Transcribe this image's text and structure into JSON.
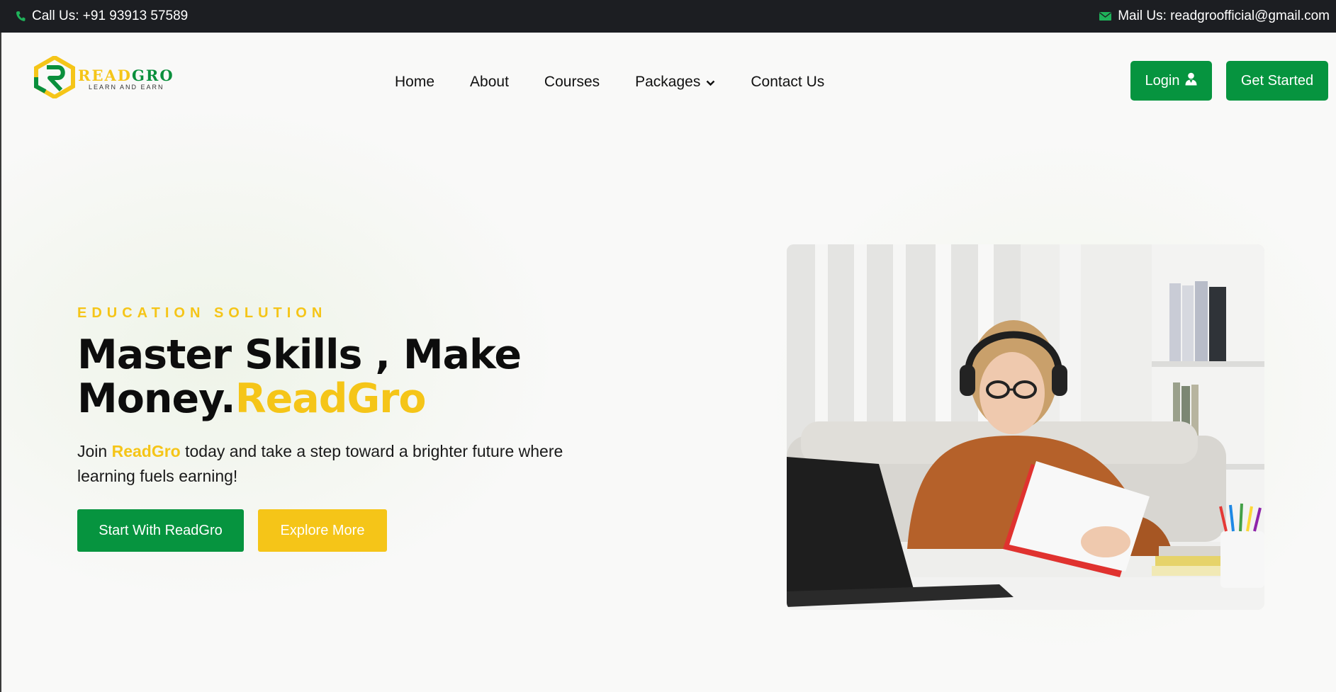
{
  "topbar": {
    "phone_text": "Call Us: +91 93913 57589",
    "mail_text": "Mail Us: readgroofficial@gmail.com",
    "phone_icon": "phone-icon",
    "mail_icon": "envelope-icon"
  },
  "brand": {
    "name_part1": "READ",
    "name_part2": "GRO",
    "tagline": "LEARN AND EARN",
    "colors": {
      "green": "#06943f",
      "yellow": "#f5c518",
      "dark": "#1c1e22"
    }
  },
  "nav": {
    "items": [
      {
        "label": "Home"
      },
      {
        "label": "About"
      },
      {
        "label": "Courses"
      },
      {
        "label": "Packages"
      },
      {
        "label": "Contact Us"
      }
    ],
    "login_label": "Login",
    "login_icon": "user-icon",
    "get_started_label": "Get Started"
  },
  "hero": {
    "eyebrow": "EDUCATION SOLUTION",
    "title_line1": "Master Skills , Make",
    "title_line2_prefix": "Money.",
    "title_line2_brand": "ReadGro",
    "desc_prefix": "Join ",
    "desc_brand": "ReadGro",
    "desc_suffix": " today and take a step toward a brighter future where learning fuels earning!",
    "primary_button": "Start With ReadGro",
    "secondary_button": "Explore More"
  }
}
